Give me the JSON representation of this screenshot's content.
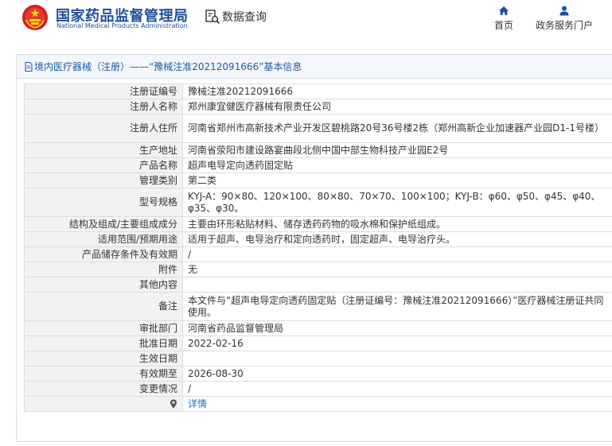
{
  "header": {
    "brand_cn": "国家药品监督管理局",
    "brand_en": "National Medical Products Administration",
    "data_query": "数据查询",
    "nav": {
      "home": "首页",
      "portal": "政务服务门户"
    }
  },
  "panel": {
    "breadcrumb": "境内医疗器械（注册）——“豫械注准20212091666”基本信息"
  },
  "rows": [
    {
      "label": "注册证编号",
      "value": "豫械注准20212091666"
    },
    {
      "label": "注册人名称",
      "value": "郑州康宜健医疗器械有限责任公司"
    },
    {
      "label": "注册人住所",
      "value": "河南省郑州市高新技术产业开发区碧桃路20号36号楼2栋（郑州高新企业加速器产业园D1-1号楼）"
    },
    {
      "label": "生产地址",
      "value": "河南省荥阳市建设路宴曲段北侧中国中部生物科技产业园E2号"
    },
    {
      "label": "产品名称",
      "value": "超声电导定向透药固定贴"
    },
    {
      "label": "管理类别",
      "value": "第二类"
    },
    {
      "label": "型号规格",
      "value": "KYJ-A：90×80、120×100、80×80、70×70、100×100；KYJ-B：φ60、φ50、φ45、φ40、φ35、φ30。"
    },
    {
      "label": "结构及组成/主要组成成分",
      "value": "主要由环形粘贴材料、储存透药药物的吸水棉和保护纸组成。"
    },
    {
      "label": "适用范围/预期用途",
      "value": "适用于超声、电导治疗和定向透药时，固定超声、电导治疗头。"
    },
    {
      "label": "产品储存条件及有效期",
      "value": "/"
    },
    {
      "label": "附件",
      "value": "无"
    },
    {
      "label": "其他内容",
      "value": ""
    },
    {
      "label": "备注",
      "value": "本文件与“超声电导定向透药固定贴（注册证编号：豫械注准20212091666）”医疗器械注册证共同使用。"
    },
    {
      "label": "审批部门",
      "value": "河南省药品监督管理局"
    },
    {
      "label": "批准日期",
      "value": "2022-02-16"
    },
    {
      "label": "生效日期",
      "value": ""
    },
    {
      "label": "有效期至",
      "value": "2026-08-30"
    },
    {
      "label": "变更情况",
      "value": "/"
    }
  ],
  "detail_link": "详情",
  "colors": {
    "brand": "#1f4f9c",
    "link": "#1d6fc9",
    "label_bg": "#f2f2f2",
    "border": "#d9dde3"
  }
}
